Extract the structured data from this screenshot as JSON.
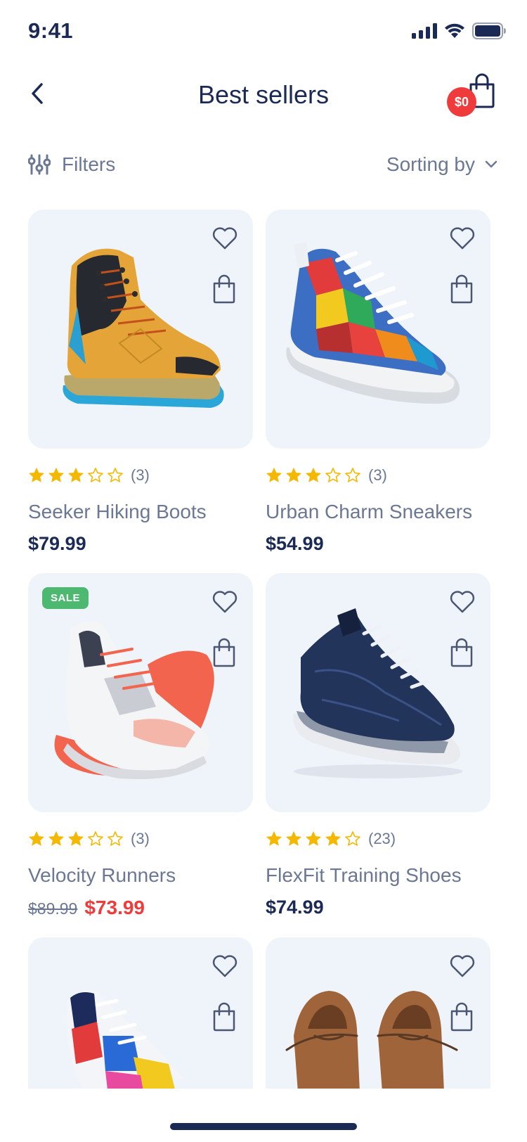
{
  "status_bar": {
    "time": "9:41"
  },
  "header": {
    "title": "Best sellers",
    "cart_badge": "$0"
  },
  "toolbar": {
    "filters_label": "Filters",
    "sort_label": "Sorting by"
  },
  "products": [
    {
      "name": "Seeker Hiking Boots",
      "price": "$79.99",
      "rating": 3,
      "review_count": "(3)",
      "on_sale": false
    },
    {
      "name": "Urban Charm Sneakers",
      "price": "$54.99",
      "rating": 3,
      "review_count": "(3)",
      "on_sale": false
    },
    {
      "name": "Velocity Runners",
      "old_price": "$89.99",
      "sale_price": "$73.99",
      "rating": 3,
      "review_count": "(3)",
      "on_sale": true,
      "sale_badge": "SALE"
    },
    {
      "name": "FlexFit Training Shoes",
      "price": "$74.99",
      "rating": 4,
      "review_count": "(23)",
      "on_sale": false
    },
    {
      "name": "",
      "rating": null
    },
    {
      "name": "",
      "rating": null
    }
  ],
  "colors": {
    "primary": "#1b2a55",
    "muted_text": "#6b7894",
    "accent_red": "#ef3b3b",
    "sale_green": "#4cb870",
    "star": "#f5b800",
    "card_bg": "#eff4fa"
  }
}
